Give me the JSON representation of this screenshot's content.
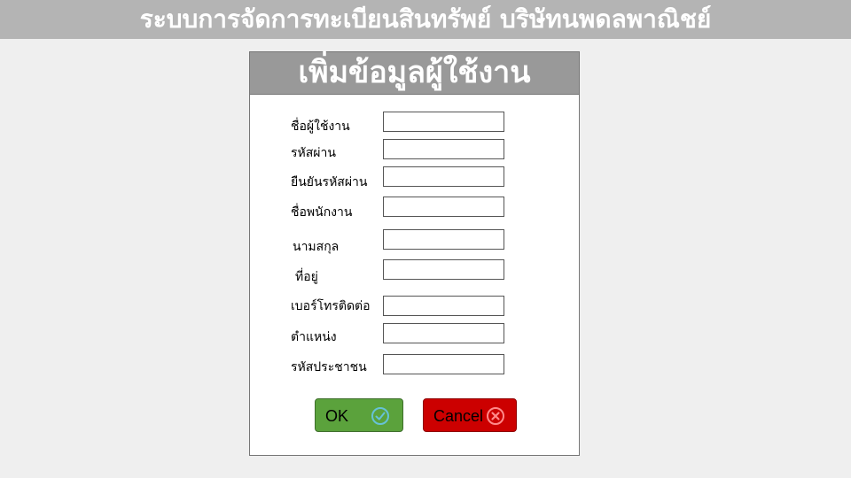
{
  "app": {
    "title": "ระบบการจัดการทะเบียนสินทรัพย์ บริษัทนพดลพาณิชย์"
  },
  "form": {
    "title": "เพิ่มข้อมูลผู้ใช้งาน",
    "fields": [
      {
        "label": "ชื่อผู้ใช้งาน",
        "value": "",
        "placeholder": ""
      },
      {
        "label": "รหัสผ่าน",
        "value": "",
        "placeholder": ""
      },
      {
        "label": "ยืนยันรหัสผ่าน",
        "value": "",
        "placeholder": ""
      },
      {
        "label": "ชื่อพนักงาน",
        "value": "",
        "placeholder": ""
      },
      {
        "label": "นามสกุล",
        "value": "",
        "placeholder": ""
      },
      {
        "label": "ที่อยู่",
        "value": "",
        "placeholder": ""
      },
      {
        "label": "เบอร์โทรติดต่อ",
        "value": "",
        "placeholder": ""
      },
      {
        "label": "ตำแหน่ง",
        "value": "",
        "placeholder": ""
      },
      {
        "label": "รหัสประชาชน",
        "value": "",
        "placeholder": ""
      }
    ],
    "ok_label": "OK",
    "cancel_label": "Cancel"
  },
  "icons": {
    "ok": "check-circle-icon",
    "cancel": "close-circle-icon"
  },
  "colors": {
    "topbar": "#b4b4b4",
    "panel_header": "#999999",
    "ok_button": "#5ba23c",
    "ok_icon": "#66c2d6",
    "cancel_button": "#cc0000",
    "cancel_icon": "#ff8a8a"
  }
}
